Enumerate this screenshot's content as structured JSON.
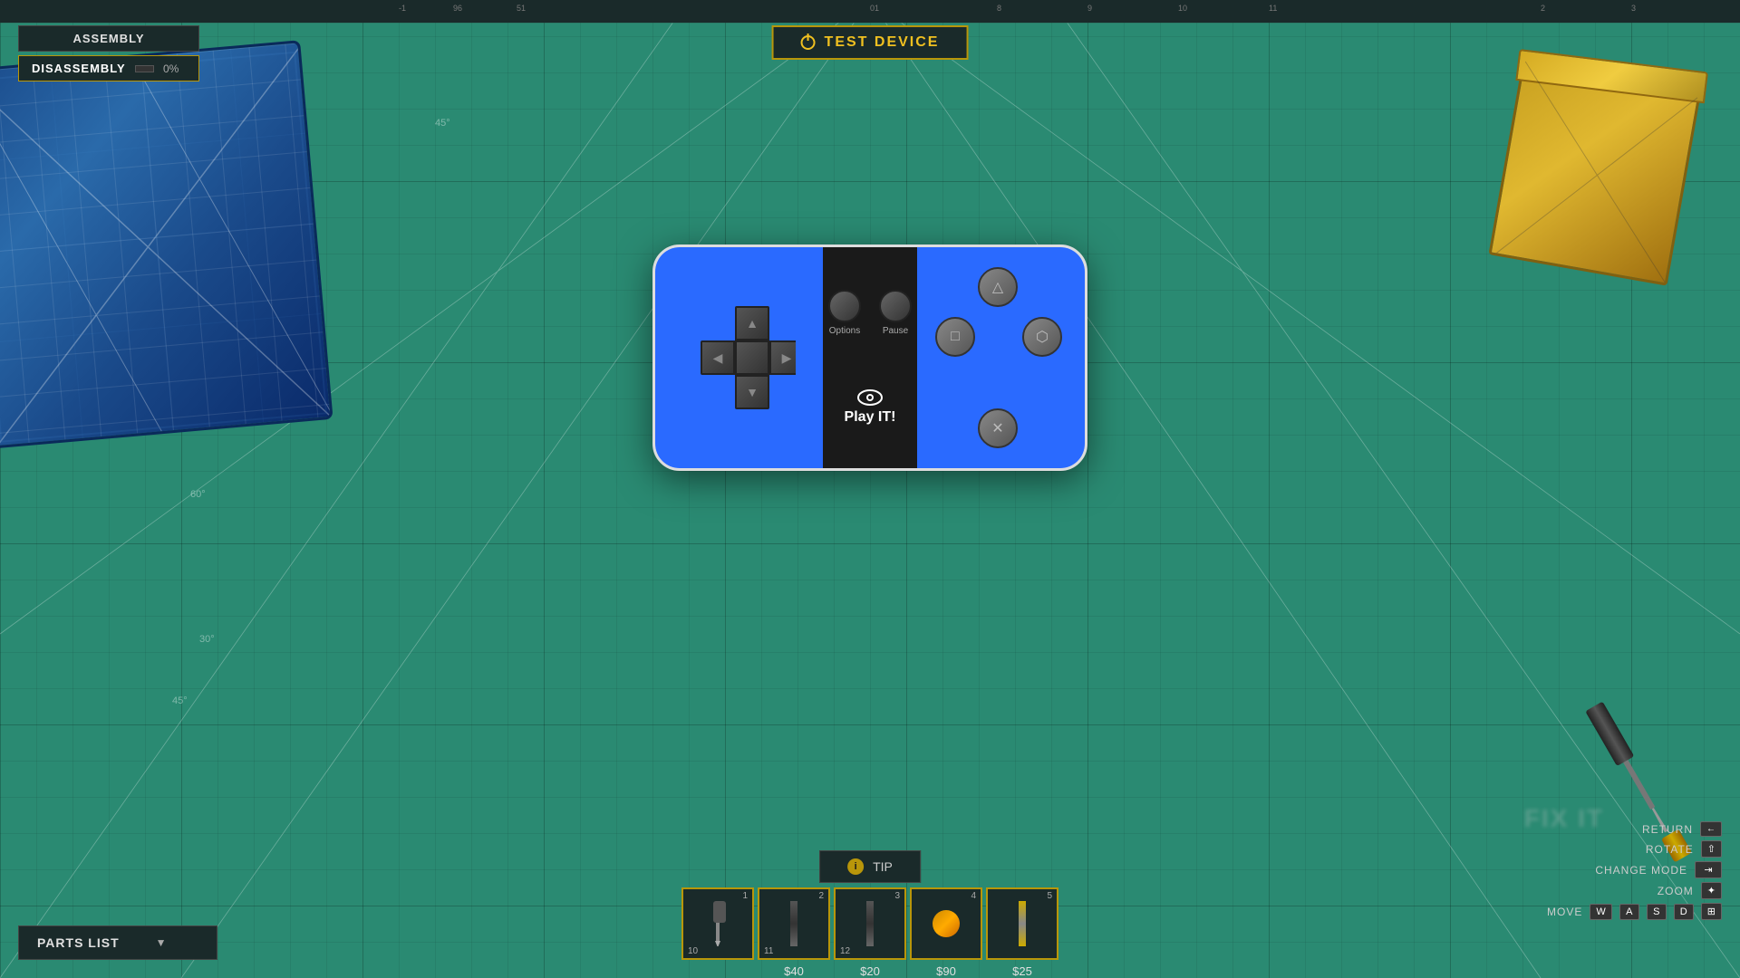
{
  "header": {
    "test_device_label": "TEST DEVICE"
  },
  "top_left": {
    "assembly_label": "ASSEMBLY",
    "disassembly_label": "DISASSEMBLY",
    "progress_percent": "0%",
    "progress_value": 0
  },
  "tip_bar": {
    "label": "TIP",
    "icon_label": "i"
  },
  "parts_list": {
    "label": "PARTS LIST"
  },
  "controls": {
    "return_label": "RETURN",
    "return_key": "←",
    "rotate_label": "ROTATE",
    "rotate_key": "⇧",
    "change_mode_label": "CHANGE MODE",
    "change_mode_key": "⇥",
    "zoom_label": "ZOOM",
    "zoom_key": "✦",
    "move_label": "MOVE",
    "move_keys": [
      "W",
      "A",
      "S",
      "D",
      "⊞"
    ]
  },
  "tool_slots": [
    {
      "number": 1,
      "count": 10,
      "price": null,
      "active": true
    },
    {
      "number": 2,
      "count": 11,
      "price": "$40",
      "active": false
    },
    {
      "number": 3,
      "count": 12,
      "price": "$20",
      "active": false
    },
    {
      "number": 4,
      "count": null,
      "price": "$90",
      "active": false
    },
    {
      "number": 5,
      "count": null,
      "price": "$25",
      "active": false
    }
  ],
  "controller": {
    "options_label": "Options",
    "pause_label": "Pause",
    "play_it_label": "Play IT!"
  },
  "angle_markers": [
    "45°",
    "60°",
    "30°",
    "45°"
  ],
  "fix_it_text": "FIX IT"
}
